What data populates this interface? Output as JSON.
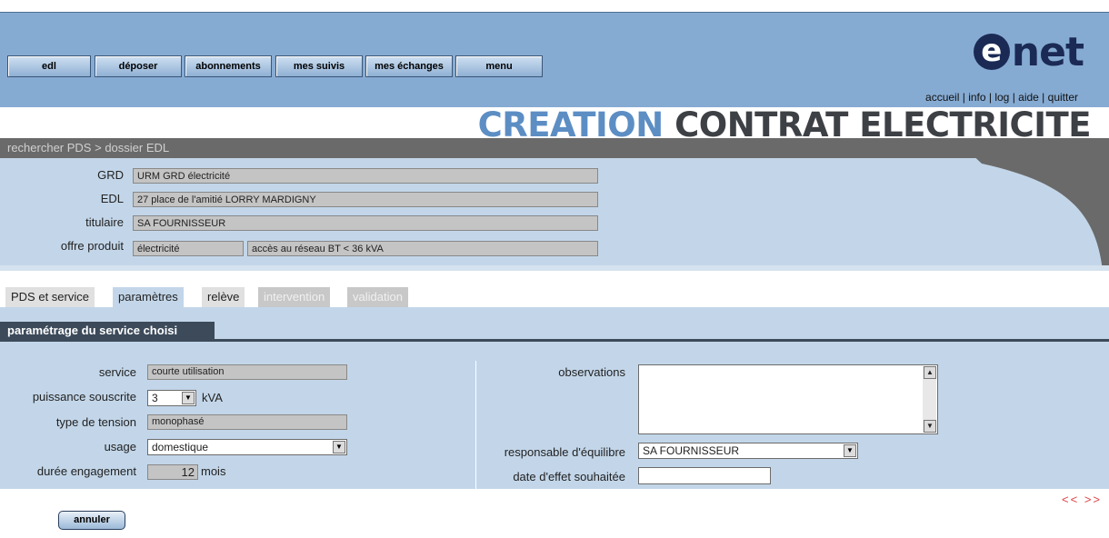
{
  "nav": {
    "edl": "edl",
    "deposer": "déposer",
    "abonnements": "abonnements",
    "mes_suivis": "mes suivis",
    "mes_echanges": "mes échanges",
    "menu": "menu"
  },
  "logo": {
    "e": "e",
    "rest": "net"
  },
  "toplinks": {
    "accueil": "accueil",
    "info": "info",
    "log": "log",
    "aide": "aide",
    "quitter": "quitter",
    "sep": " | "
  },
  "title": {
    "part1": "CREATION",
    "part2": "CONTRAT ELECTRICITE"
  },
  "breadcrumb": {
    "item1": "rechercher PDS",
    "sep": " > ",
    "item2": "dossier EDL"
  },
  "dossier": {
    "grd_label": "GRD",
    "grd_value": "URM GRD électricité",
    "edl_label": "EDL",
    "edl_value": "27 place de l'amitié LORRY MARDIGNY",
    "titulaire_label": "titulaire",
    "titulaire_value": "SA FOURNISSEUR",
    "offre_label": "offre produit",
    "offre_value1": "électricité",
    "offre_value2": "accès au réseau BT < 36 kVA"
  },
  "tabs": [
    {
      "label": "PDS et service",
      "state": "normal"
    },
    {
      "label": "paramètres",
      "state": "active"
    },
    {
      "label": "relève",
      "state": "normal"
    },
    {
      "label": "intervention",
      "state": "disabled"
    },
    {
      "label": "validation",
      "state": "disabled"
    }
  ],
  "section": {
    "title": "paramétrage du service choisi"
  },
  "form": {
    "service_label": "service",
    "service_value": "courte utilisation",
    "puissance_label": "puissance souscrite",
    "puissance_value": "3",
    "puissance_unit": "kVA",
    "tension_label": "type de tension",
    "tension_value": "monophasé",
    "usage_label": "usage",
    "usage_value": "domestique",
    "duree_label": "durée engagement",
    "duree_value": "12",
    "duree_unit": "mois",
    "observations_label": "observations",
    "observations_value": "",
    "responsable_label": "responsable d'équilibre",
    "responsable_value": "SA FOURNISSEUR",
    "date_label": "date d'effet souhaitée",
    "date_value": ""
  },
  "pager": {
    "prev": "<<",
    "next": ">>"
  },
  "buttons": {
    "cancel": "annuler"
  },
  "colors": {
    "header": "#86abd3",
    "panel": "#c3d6e9",
    "title_blue": "#5c8ec4",
    "title_dark": "#3d4045",
    "section": "#3c4a5a",
    "pager": "#dd4444"
  }
}
